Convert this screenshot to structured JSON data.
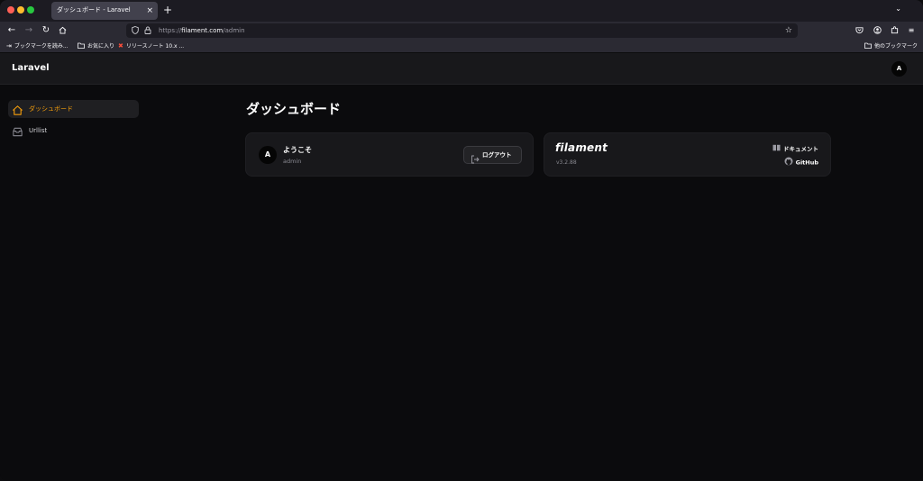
{
  "browser": {
    "tab_title": "ダッシュボード - Laravel",
    "tab_close": "×",
    "new_tab": "+",
    "tab_list": "⌄",
    "url_scheme": "https://",
    "url_host": "filament.com",
    "url_path": "/admin",
    "bookmarks": [
      {
        "label": "ブックマークを読み...",
        "icon": "import-icon"
      },
      {
        "label": "お気に入り",
        "icon": "folder-icon"
      },
      {
        "label": "リリースノート 10.x ...",
        "icon": "laravel-icon"
      }
    ],
    "other_bookmarks": "他のブックマーク"
  },
  "app": {
    "brand": "Laravel",
    "user_initial": "A"
  },
  "sidebar": {
    "items": [
      {
        "label": "ダッシュボード",
        "icon": "home-icon",
        "active": true
      },
      {
        "label": "Urllist",
        "icon": "inbox-icon",
        "active": false
      }
    ]
  },
  "main": {
    "title": "ダッシュボード",
    "welcome": {
      "initial": "A",
      "title": "ようこそ",
      "username": "admin",
      "logout_label": "ログアウト"
    },
    "filament": {
      "logo": "filament",
      "version": "v3.2.88",
      "docs_label": "ドキュメント",
      "github_label": "GitHub"
    }
  },
  "colors": {
    "accent": "#f59e0b",
    "background": "#0b0b0d",
    "card": "#18181b"
  }
}
